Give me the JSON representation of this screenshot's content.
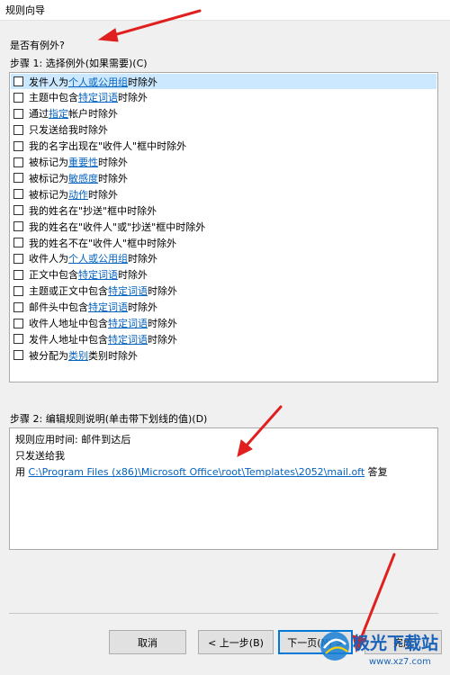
{
  "window": {
    "title": "规则向导"
  },
  "question": "是否有例外?",
  "step1": {
    "label": "步骤 1: 选择例外(如果需要)(C)",
    "items": [
      {
        "before": "发件人为 ",
        "link": "个人或公用组",
        "after": " 时除外",
        "selected": true
      },
      {
        "before": "主题中包含 ",
        "link": "特定词语",
        "after": " 时除外"
      },
      {
        "before": "通过 ",
        "link": "指定",
        "after": " 帐户时除外"
      },
      {
        "before": "只发送给我时除外",
        "link": "",
        "after": ""
      },
      {
        "before": "我的名字出现在\"收件人\"框中时除外",
        "link": "",
        "after": ""
      },
      {
        "before": "被标记为 ",
        "link": "重要性",
        "after": " 时除外"
      },
      {
        "before": "被标记为 ",
        "link": "敏感度",
        "after": " 时除外"
      },
      {
        "before": "被标记为 ",
        "link": "动作",
        "after": " 时除外"
      },
      {
        "before": "我的姓名在\"抄送\"框中时除外",
        "link": "",
        "after": ""
      },
      {
        "before": "我的姓名在\"收件人\"或\"抄送\"框中时除外",
        "link": "",
        "after": ""
      },
      {
        "before": "我的姓名不在\"收件人\"框中时除外",
        "link": "",
        "after": ""
      },
      {
        "before": "收件人为 ",
        "link": "个人或公用组",
        "after": " 时除外"
      },
      {
        "before": "正文中包含 ",
        "link": "特定词语",
        "after": " 时除外"
      },
      {
        "before": "主题或正文中包含 ",
        "link": "特定词语",
        "after": " 时除外"
      },
      {
        "before": "邮件头中包含 ",
        "link": "特定词语",
        "after": " 时除外"
      },
      {
        "before": "收件人地址中包含 ",
        "link": "特定词语",
        "after": " 时除外"
      },
      {
        "before": "发件人地址中包含 ",
        "link": "特定词语",
        "after": " 时除外"
      },
      {
        "before": "被分配为 ",
        "link": "类别",
        "after": " 类别时除外"
      }
    ]
  },
  "step2": {
    "label": "步骤 2: 编辑规则说明(单击带下划线的值)(D)",
    "line1": "规则应用时间: 邮件到达后",
    "line2": "只发送给我",
    "line3_prefix": "用 ",
    "line3_link": "C:\\Program Files (x86)\\Microsoft Office\\root\\Templates\\2052\\mail.oft",
    "line3_suffix": " 答复"
  },
  "buttons": {
    "cancel": "取消",
    "back": "< 上一步(B)",
    "next": "下一页(N) >",
    "finish": "完成"
  },
  "watermark": {
    "text": "极光下载站",
    "url": "www.xz7.com"
  },
  "colors": {
    "link": "#0563c1",
    "selection": "#cce8ff",
    "annotation": "#e0201f",
    "focus": "#0078d7"
  }
}
